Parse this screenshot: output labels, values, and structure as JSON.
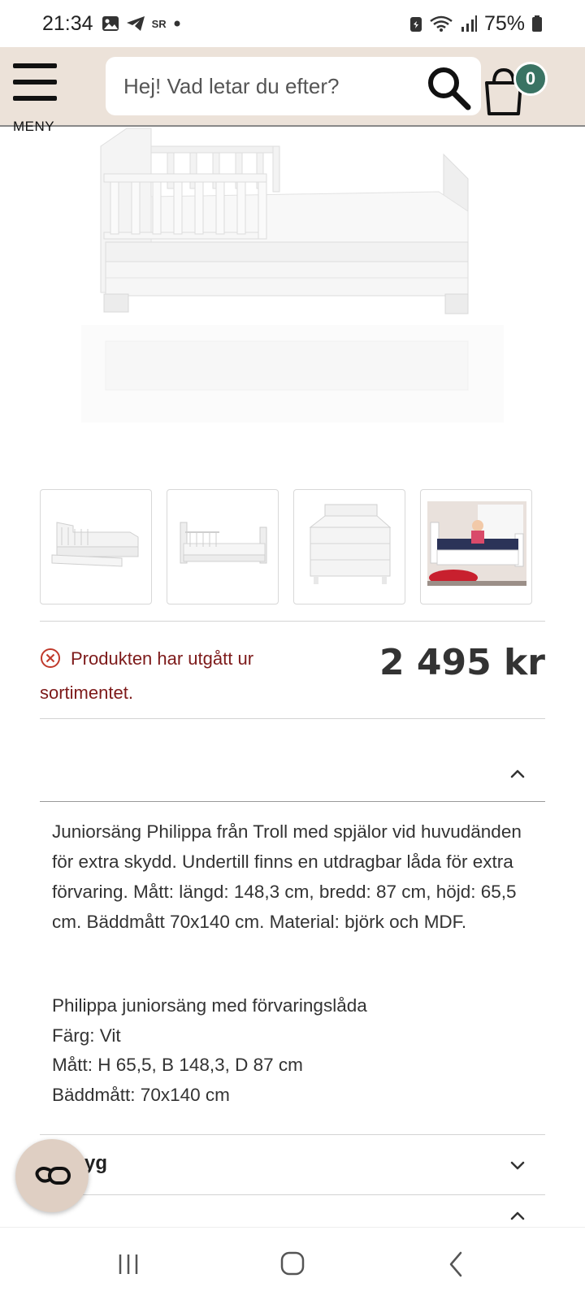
{
  "status_bar": {
    "time": "21:34",
    "battery": "75%",
    "small_label": "SR"
  },
  "header": {
    "menu_label": "MENY",
    "search_placeholder": "Hej! Vad letar du efter?",
    "cart_count": "0"
  },
  "product": {
    "status_text": "Produkten har utgått ur sortimentet.",
    "price": "2 495 kr",
    "description": "Juniorsäng Philippa från Troll med spjälor vid huvudänden för extra skydd. Undertill finns en utdragbar låda för extra förvaring. Mått: längd: 148,3 cm, bredd: 87 cm, höjd: 65,5 cm. Bäddmått 70x140 cm. Material: björk och MDF.",
    "specs": [
      "Philippa juniorsäng med förvaringslåda",
      "Färg: Vit",
      "Mått: H 65,5, B 148,3, D 87 cm",
      "Bäddmått: 70x140 cm"
    ],
    "next_section_fragment": "yg"
  },
  "colors": {
    "header_bg": "#ece2d9",
    "badge": "#3a7363",
    "alert": "#7d1a1a",
    "chat_fab": "#dfcfc3"
  },
  "icons": [
    "menu-icon",
    "search-icon",
    "cart-icon",
    "error-circle-icon",
    "chevron-up-icon",
    "chevron-down-icon",
    "chat-icon",
    "recent-apps-icon",
    "home-icon",
    "back-icon"
  ]
}
